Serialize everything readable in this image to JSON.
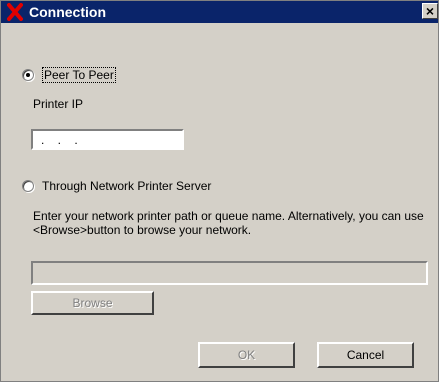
{
  "title": "Connection",
  "close_glyph": "×",
  "peer": {
    "label": "Peer To Peer",
    "checked": true
  },
  "printer_ip": {
    "label": "Printer IP",
    "value": ". . ."
  },
  "network": {
    "label": "Through Network Printer Server",
    "checked": false
  },
  "hint": "Enter your network printer path or queue name. Alternatively, you can use <Browse>button to browse your network.",
  "path_value": "",
  "buttons": {
    "browse": "Browse",
    "ok": "OK",
    "cancel": "Cancel"
  },
  "colors": {
    "title_bg": "#0a246a",
    "logo": "#cc0000",
    "face": "#d4d0c8"
  }
}
